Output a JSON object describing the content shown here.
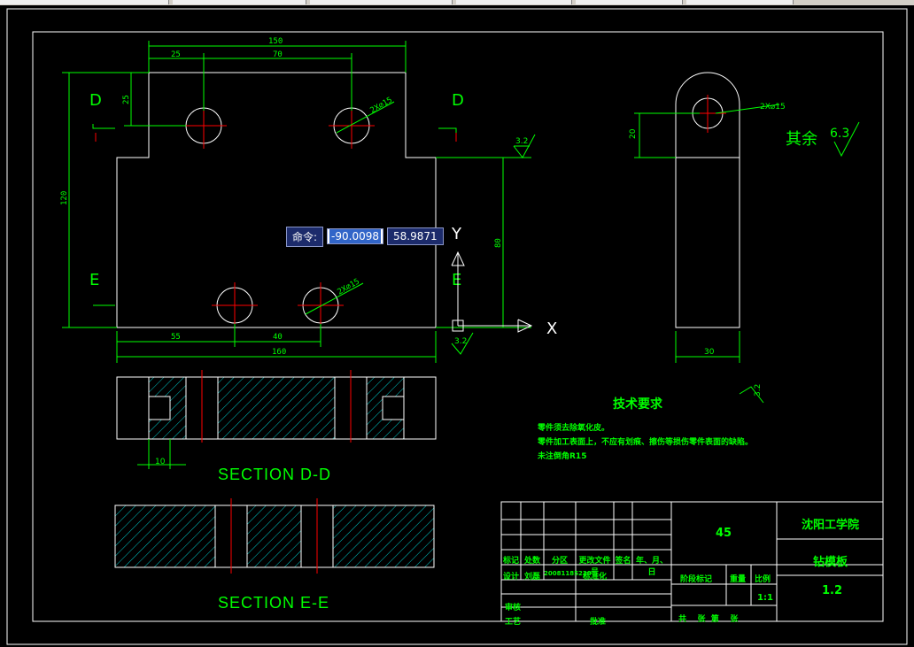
{
  "dynamic_input": {
    "prompt": "命令:",
    "x_value": "-90.0098",
    "y_value": "58.9871"
  },
  "colors": {
    "background": "#000000",
    "outline": "#ffffff",
    "dimension": "#00ff00",
    "centerline": "#ff0000",
    "hatch": "#00c8c8",
    "title_text": "#00ff00"
  },
  "drawing": {
    "front_view": {
      "dims": [
        "150",
        "25",
        "70",
        "160",
        "55",
        "40",
        "120",
        "80",
        "25"
      ],
      "hole_note_top": "2X⌀15",
      "hole_note_bottom": "2X⌀15",
      "roughness": "3.2"
    },
    "section_labels": {
      "d_left": "D",
      "d_right": "D",
      "e_left": "E",
      "e_right": "E"
    },
    "side_view": {
      "dims": [
        "20",
        "30"
      ],
      "hole_note": "2X⌀15",
      "roughness_note": "其余",
      "roughness_value": "6.3",
      "roughness_low": "3.2"
    },
    "section_dd_dim": "10",
    "section_dd": "SECTION D-D",
    "section_ee": "SECTION E-E",
    "ucs": {
      "x": "X",
      "y": "Y"
    },
    "tech_requirements": {
      "title": "技术要求",
      "lines": [
        "零件须去除氧化皮。",
        "零件加工表面上，不应有划痕、擦伤等损伤零件表面的缺陷。",
        "未注倒角R15"
      ]
    },
    "title_block": {
      "material": "45",
      "school": "沈阳工学院",
      "part_name": "钻模板",
      "drawing_no": "1.2",
      "scale": "1:1",
      "headers_row": [
        "标记",
        "处数",
        "分区",
        "更改文件号",
        "签名",
        "年、月、日"
      ],
      "design": "设计",
      "design_name": "刘磊",
      "design_id": "20081185220",
      "standardize": "标准化",
      "stage_mark": "阶段标记",
      "weight": "重量",
      "ratio": "比例",
      "review": "审核",
      "process": "工艺",
      "approve": "批准",
      "sheets": "共    张  第    张"
    }
  }
}
